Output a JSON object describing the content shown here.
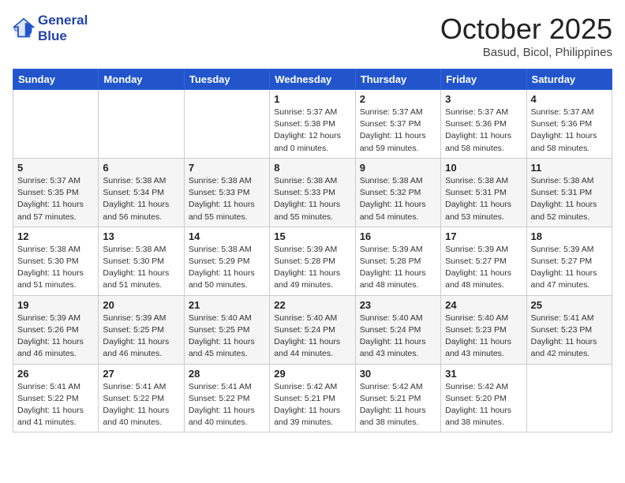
{
  "header": {
    "logo_line1": "General",
    "logo_line2": "Blue",
    "month": "October 2025",
    "location": "Basud, Bicol, Philippines"
  },
  "weekdays": [
    "Sunday",
    "Monday",
    "Tuesday",
    "Wednesday",
    "Thursday",
    "Friday",
    "Saturday"
  ],
  "weeks": [
    [
      {
        "day": "",
        "info": ""
      },
      {
        "day": "",
        "info": ""
      },
      {
        "day": "",
        "info": ""
      },
      {
        "day": "1",
        "info": "Sunrise: 5:37 AM\nSunset: 5:38 PM\nDaylight: 12 hours\nand 0 minutes."
      },
      {
        "day": "2",
        "info": "Sunrise: 5:37 AM\nSunset: 5:37 PM\nDaylight: 11 hours\nand 59 minutes."
      },
      {
        "day": "3",
        "info": "Sunrise: 5:37 AM\nSunset: 5:36 PM\nDaylight: 11 hours\nand 58 minutes."
      },
      {
        "day": "4",
        "info": "Sunrise: 5:37 AM\nSunset: 5:36 PM\nDaylight: 11 hours\nand 58 minutes."
      }
    ],
    [
      {
        "day": "5",
        "info": "Sunrise: 5:37 AM\nSunset: 5:35 PM\nDaylight: 11 hours\nand 57 minutes."
      },
      {
        "day": "6",
        "info": "Sunrise: 5:38 AM\nSunset: 5:34 PM\nDaylight: 11 hours\nand 56 minutes."
      },
      {
        "day": "7",
        "info": "Sunrise: 5:38 AM\nSunset: 5:33 PM\nDaylight: 11 hours\nand 55 minutes."
      },
      {
        "day": "8",
        "info": "Sunrise: 5:38 AM\nSunset: 5:33 PM\nDaylight: 11 hours\nand 55 minutes."
      },
      {
        "day": "9",
        "info": "Sunrise: 5:38 AM\nSunset: 5:32 PM\nDaylight: 11 hours\nand 54 minutes."
      },
      {
        "day": "10",
        "info": "Sunrise: 5:38 AM\nSunset: 5:31 PM\nDaylight: 11 hours\nand 53 minutes."
      },
      {
        "day": "11",
        "info": "Sunrise: 5:38 AM\nSunset: 5:31 PM\nDaylight: 11 hours\nand 52 minutes."
      }
    ],
    [
      {
        "day": "12",
        "info": "Sunrise: 5:38 AM\nSunset: 5:30 PM\nDaylight: 11 hours\nand 51 minutes."
      },
      {
        "day": "13",
        "info": "Sunrise: 5:38 AM\nSunset: 5:30 PM\nDaylight: 11 hours\nand 51 minutes."
      },
      {
        "day": "14",
        "info": "Sunrise: 5:38 AM\nSunset: 5:29 PM\nDaylight: 11 hours\nand 50 minutes."
      },
      {
        "day": "15",
        "info": "Sunrise: 5:39 AM\nSunset: 5:28 PM\nDaylight: 11 hours\nand 49 minutes."
      },
      {
        "day": "16",
        "info": "Sunrise: 5:39 AM\nSunset: 5:28 PM\nDaylight: 11 hours\nand 48 minutes."
      },
      {
        "day": "17",
        "info": "Sunrise: 5:39 AM\nSunset: 5:27 PM\nDaylight: 11 hours\nand 48 minutes."
      },
      {
        "day": "18",
        "info": "Sunrise: 5:39 AM\nSunset: 5:27 PM\nDaylight: 11 hours\nand 47 minutes."
      }
    ],
    [
      {
        "day": "19",
        "info": "Sunrise: 5:39 AM\nSunset: 5:26 PM\nDaylight: 11 hours\nand 46 minutes."
      },
      {
        "day": "20",
        "info": "Sunrise: 5:39 AM\nSunset: 5:25 PM\nDaylight: 11 hours\nand 46 minutes."
      },
      {
        "day": "21",
        "info": "Sunrise: 5:40 AM\nSunset: 5:25 PM\nDaylight: 11 hours\nand 45 minutes."
      },
      {
        "day": "22",
        "info": "Sunrise: 5:40 AM\nSunset: 5:24 PM\nDaylight: 11 hours\nand 44 minutes."
      },
      {
        "day": "23",
        "info": "Sunrise: 5:40 AM\nSunset: 5:24 PM\nDaylight: 11 hours\nand 43 minutes."
      },
      {
        "day": "24",
        "info": "Sunrise: 5:40 AM\nSunset: 5:23 PM\nDaylight: 11 hours\nand 43 minutes."
      },
      {
        "day": "25",
        "info": "Sunrise: 5:41 AM\nSunset: 5:23 PM\nDaylight: 11 hours\nand 42 minutes."
      }
    ],
    [
      {
        "day": "26",
        "info": "Sunrise: 5:41 AM\nSunset: 5:22 PM\nDaylight: 11 hours\nand 41 minutes."
      },
      {
        "day": "27",
        "info": "Sunrise: 5:41 AM\nSunset: 5:22 PM\nDaylight: 11 hours\nand 40 minutes."
      },
      {
        "day": "28",
        "info": "Sunrise: 5:41 AM\nSunset: 5:22 PM\nDaylight: 11 hours\nand 40 minutes."
      },
      {
        "day": "29",
        "info": "Sunrise: 5:42 AM\nSunset: 5:21 PM\nDaylight: 11 hours\nand 39 minutes."
      },
      {
        "day": "30",
        "info": "Sunrise: 5:42 AM\nSunset: 5:21 PM\nDaylight: 11 hours\nand 38 minutes."
      },
      {
        "day": "31",
        "info": "Sunrise: 5:42 AM\nSunset: 5:20 PM\nDaylight: 11 hours\nand 38 minutes."
      },
      {
        "day": "",
        "info": ""
      }
    ]
  ]
}
